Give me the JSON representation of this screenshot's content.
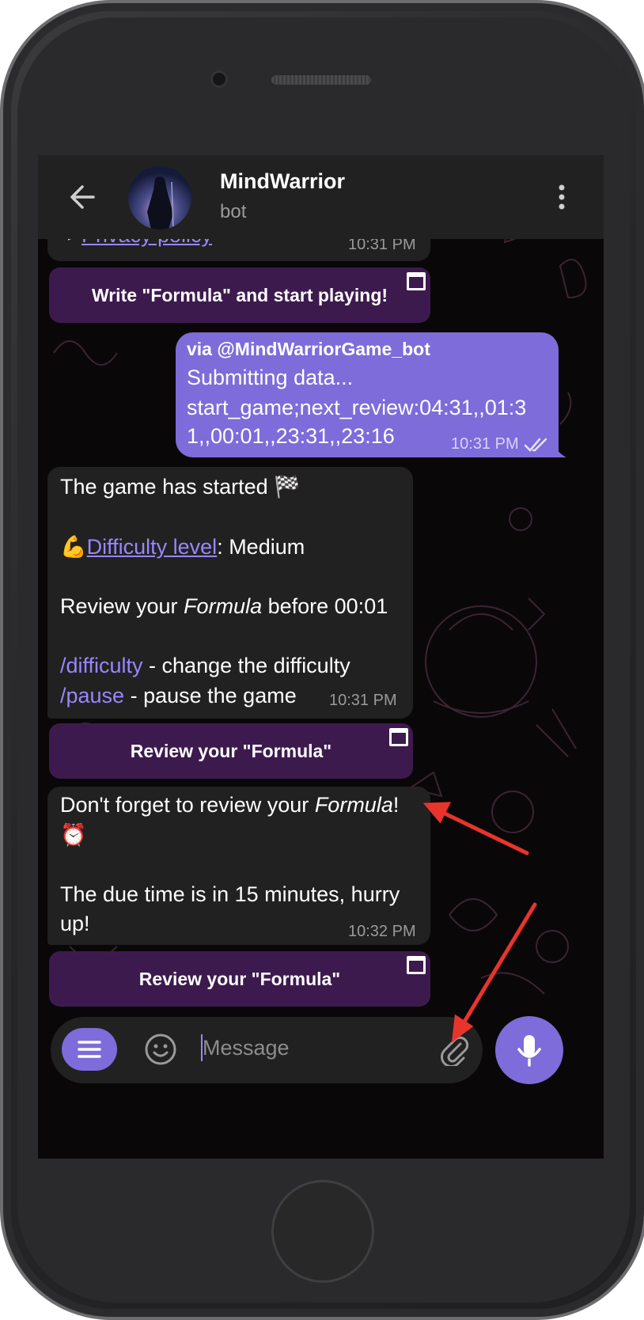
{
  "header": {
    "title": "MindWarrior",
    "subtitle": "bot"
  },
  "messages": {
    "m1": {
      "bullet": "▸",
      "link": "Privacy policy",
      "time": "10:31 PM"
    },
    "btn1": {
      "label": "Write \"Formula\" and start playing!"
    },
    "out1": {
      "via": "via @MindWarriorGame_bot",
      "line1": "Submitting data...",
      "line2": "start_game;next_review:04:31,,01:3",
      "line3": "1,,00:01,,23:31,,23:16",
      "time": "10:31 PM"
    },
    "m2": {
      "line1_text": "The game has started",
      "line1_emoji": "🏁",
      "line2_emoji": "💪",
      "line2_link": "Difficulty level",
      "line2_rest": ": Medium",
      "line3_pre": "Review your ",
      "line3_italic": "Formula",
      "line3_post": " before 00:01",
      "cmd1": "/difficulty",
      "cmd1_rest": " - change the difficulty",
      "cmd2": "/pause",
      "cmd2_rest": " - pause the game",
      "time": "10:31 PM"
    },
    "btn2": {
      "label": "Review your \"Formula\""
    },
    "m3": {
      "line1_pre": "Don't forget to review your ",
      "line1_italic": "Formula",
      "line1_post": "!",
      "line2_emoji": "⏰",
      "line3": "The due time is in 15 minutes, hurry",
      "line4": "up!",
      "time": "10:32 PM"
    },
    "btn3": {
      "label": "Review your \"Formula\""
    }
  },
  "input": {
    "placeholder": "Message"
  },
  "icons": {
    "back": "arrow-left-icon",
    "menu": "more-vertical-icon",
    "keyboard_button": "open-window-icon",
    "emoji": "smile-icon",
    "attach": "paperclip-icon",
    "mic": "microphone-icon",
    "bot_menu": "hamburger-icon",
    "read": "double-check-icon"
  },
  "colors": {
    "accent": "#7d6cd9",
    "link": "#9a86ff",
    "keyboard_button_bg": "#3d1a4e",
    "bubble_in": "#212121",
    "annotation_arrow": "#e8342b"
  }
}
